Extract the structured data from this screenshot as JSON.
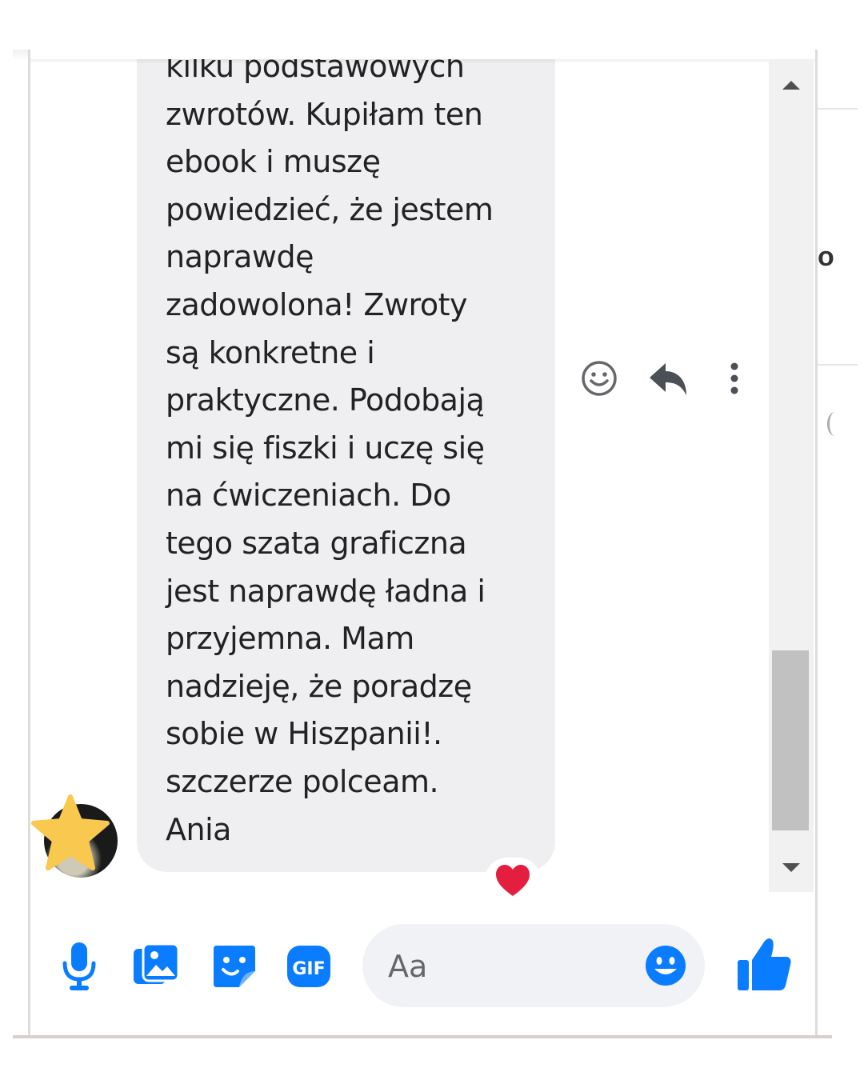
{
  "message": {
    "text_lines": [
      "kilku podstawowych",
      "zwrotów. Kupiłam ten",
      "ebook i muszę",
      "powiedzieć, że jestem",
      "naprawdę",
      "zadowolona! Zwroty",
      "są konkretne i",
      "praktyczne. Podobają",
      "mi się fiszki i uczę się",
      "na ćwiczeniach. Do",
      "tego szata graficzna",
      "jest naprawdę ładna i",
      "przyjemna. Mam",
      "nadzieję, że poradzę",
      "sobie w Hiszpanii!.",
      "szczerze polceam.",
      "Ania"
    ],
    "reaction": "heart-icon",
    "actions": [
      "smile-icon",
      "reply-icon",
      "more-vertical-icon"
    ]
  },
  "side_fragment": {
    "char": "o"
  },
  "composer": {
    "placeholder": "Aa",
    "icons": [
      "microphone-icon",
      "photo-icon",
      "sticker-icon",
      "gif-icon",
      "emoji-icon",
      "thumbs-up-icon"
    ],
    "accent_color": "#0a7cff"
  },
  "colors": {
    "bubble": "#efeff1",
    "scrollbar_thumb": "#c1c1c1",
    "scrollbar_track": "#f1f1f1",
    "star": "#f9c84e",
    "heart": "#e41e3f"
  }
}
